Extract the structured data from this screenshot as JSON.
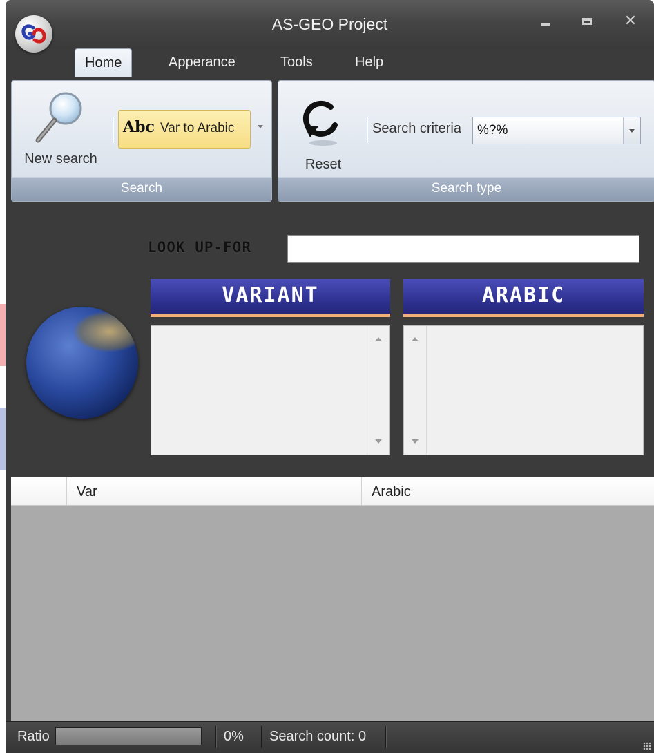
{
  "window": {
    "title": "AS-GEO Project"
  },
  "tabs": [
    {
      "label": "Home",
      "active": true
    },
    {
      "label": "Apperance",
      "active": false
    },
    {
      "label": "Tools",
      "active": false
    },
    {
      "label": "Help",
      "active": false
    }
  ],
  "ribbon": {
    "search_group": {
      "new_search_label": "New search",
      "direction_dropdown": {
        "icon_text": "Abc",
        "selected": "Var to Arabic"
      },
      "caption": "Search"
    },
    "search_type_group": {
      "reset_label": "Reset",
      "criteria_label": "Search criteria",
      "criteria_value": "%?%",
      "caption": "Search type"
    }
  },
  "lookup": {
    "label": "LOOK UP-FOR",
    "value": ""
  },
  "lists": {
    "variant_header": "VARIANT",
    "arabic_header": "ARABIC"
  },
  "grid": {
    "columns": [
      "Var",
      "Arabic"
    ],
    "rows": []
  },
  "statusbar": {
    "ratio_label": "Ratio",
    "progress_percent": 0,
    "percent_text": "0%",
    "search_count_text": "Search count: 0"
  },
  "icons": {
    "app_logo": "app-logo-icon",
    "new_search": "magnifier-icon",
    "reset": "refresh-icon",
    "globe": "globe-icon"
  },
  "colors": {
    "title_bar": "#454545",
    "ribbon_caption": "#8d9bb0",
    "list_header": "#2c2f8c",
    "list_header_underline": "#f0b07a",
    "dropdown_highlight": "#f7dd84",
    "grid_background": "#aaaaaa"
  }
}
